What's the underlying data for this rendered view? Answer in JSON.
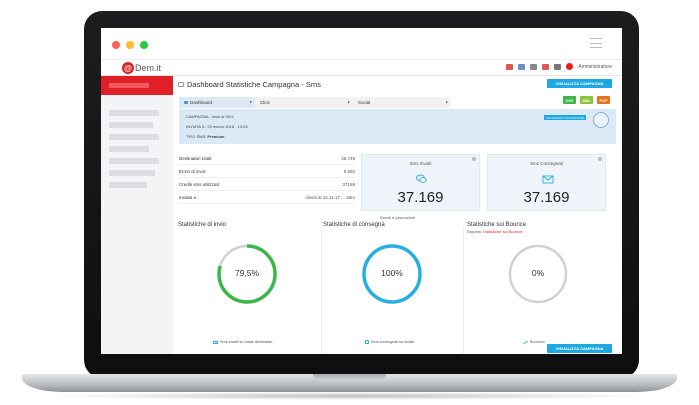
{
  "app": {
    "logo_text": "Dem.it",
    "logo_mark": "@",
    "user_label": "Amministratore"
  },
  "colors": {
    "brand_red": "#e11f26",
    "accent_blue": "#1fa7e3",
    "gauge_green": "#3db54a",
    "gauge_blue": "#29aee3",
    "gauge_grey": "#cfd1d4"
  },
  "page": {
    "title": "Dashboard Statistiche Campagna - Sms"
  },
  "actions": {
    "visualizza_top": "VISUALIZZA CAMPAGNA",
    "visualizza_bottom": "VISUALIZZA CAMPAGNA",
    "export": [
      "CSV",
      "XML",
      "PDF"
    ]
  },
  "tabs": [
    {
      "label": "Dashboard",
      "active": true
    },
    {
      "label": "Click",
      "active": false
    },
    {
      "label": "Social",
      "active": false
    }
  ],
  "info": {
    "campagna": "CAMPAGNA : Invio al 30%",
    "inviata": "INVIATA IL: 29 marzo 2018 - 14:53",
    "tipo_label": "TIPO SMS:",
    "tipo_value": "Premium",
    "badge": "GLOSSARIO STATISTICHE"
  },
  "stats_rows": [
    {
      "label": "Destinatari totali:",
      "value": "46.749"
    },
    {
      "label": "Errori di invio:",
      "value": "9.580"
    },
    {
      "label": "Crediti sms utilizzati:",
      "value": "37169"
    },
    {
      "label": "Inviata a :",
      "value": "clienti al 12.11.17 ... altro"
    }
  ],
  "cards": [
    {
      "label": "Sms Inviati",
      "value": "37.169",
      "icon": "chat-bubbles-icon"
    },
    {
      "label": "Sms Consegnati",
      "value": "37.169",
      "icon": "envelope-icon"
    }
  ],
  "center_label": "Scenti e promozioni",
  "sections": [
    {
      "title": "Statistiche di invio",
      "percent_label": "79,5%",
      "fraction": 0.795,
      "footer": "Sms inviati su totale destinatari"
    },
    {
      "title": "Statistiche di consegna",
      "percent_label": "100%",
      "fraction": 1.0,
      "footer": "Sms consegnati su inviati"
    },
    {
      "title": "Statistiche sui Bounce",
      "subtitle_prefix": "Esporta:",
      "subtitle_link": "Statistiche sui Bounce",
      "percent_label": "0%",
      "fraction": 0.0,
      "footer": "Bounces"
    }
  ]
}
